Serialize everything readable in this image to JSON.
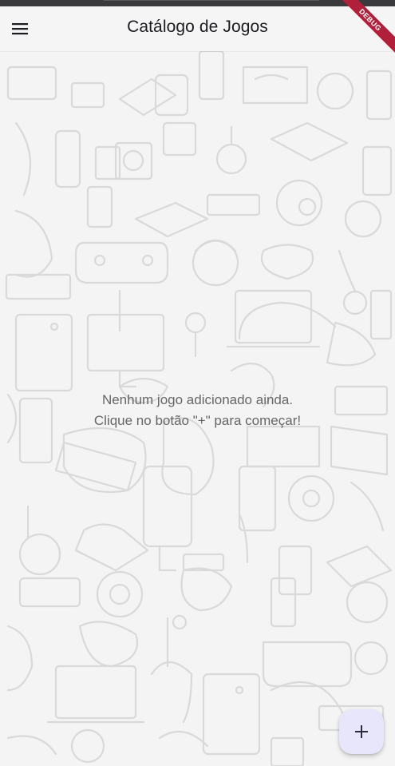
{
  "app_bar": {
    "title": "Catálogo de Jogos",
    "menu_icon": "menu-icon"
  },
  "debug_banner": {
    "label": "DEBUG",
    "color": "#b0203a"
  },
  "empty_state": {
    "line1": "Nenhum jogo adicionado ainda.",
    "line2": "Clique no botão \"+\" para começar!"
  },
  "fab": {
    "icon": "plus-icon",
    "color": "#e8e6fa"
  },
  "background": {
    "pattern": "gaming-doodle-pattern",
    "color": "#f4f4f5"
  }
}
